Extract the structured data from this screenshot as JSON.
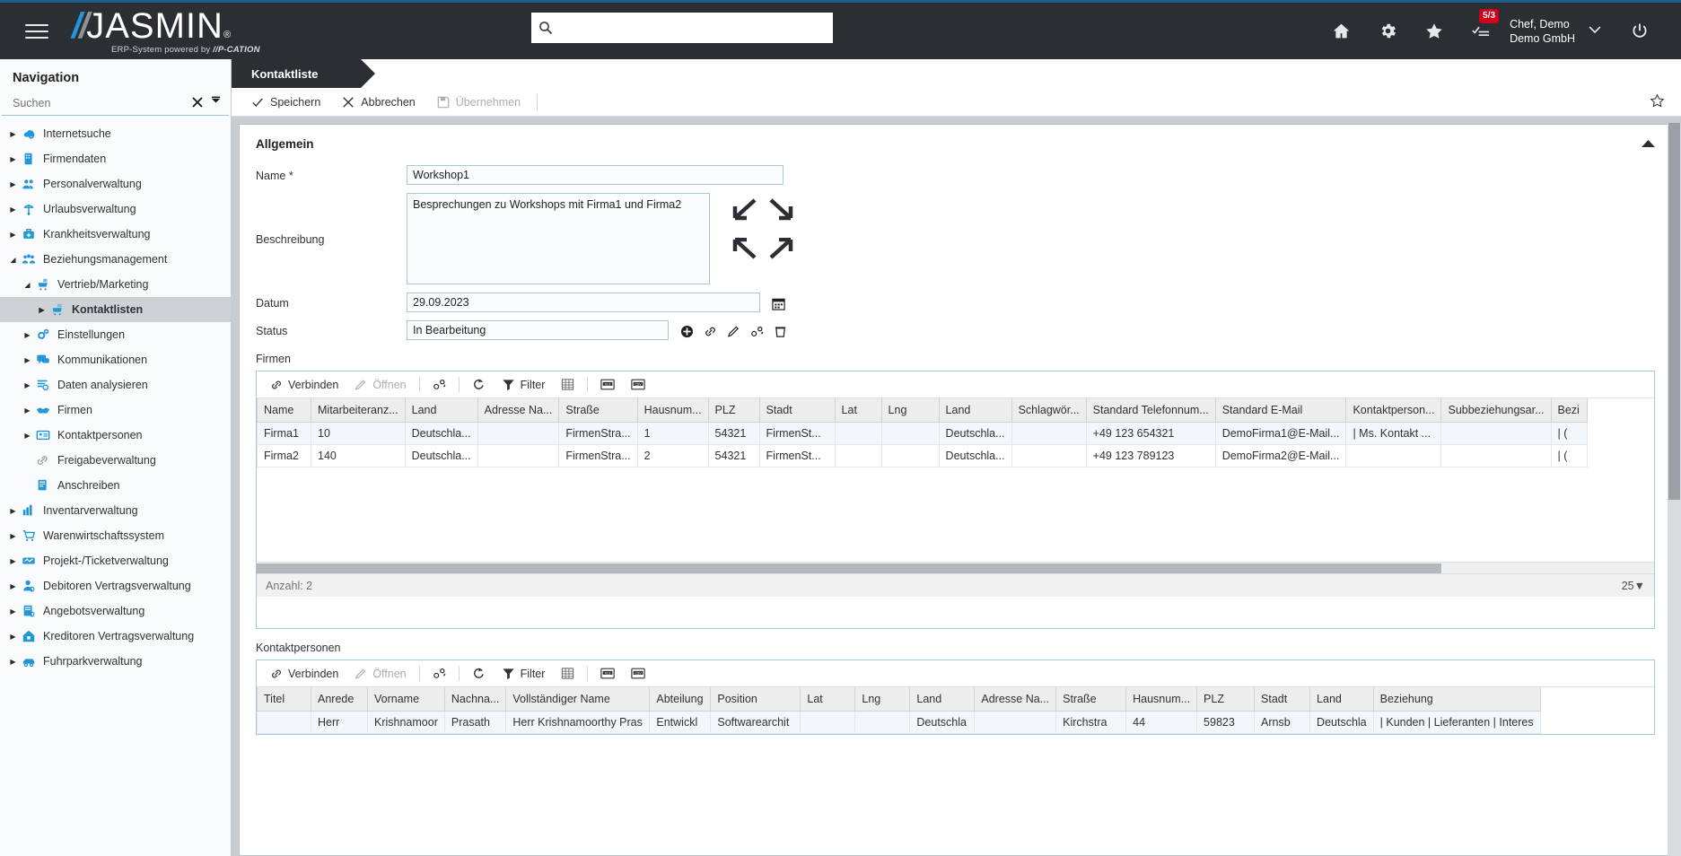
{
  "header": {
    "logo_slash": "//",
    "logo_text": "JASMIN",
    "logo_reg": "®",
    "tagline_pre": "ERP-System powered by ",
    "tagline_brand": "//P-CATION",
    "search_placeholder": "",
    "search_value": "",
    "notification_badge": "5/3",
    "user_name": "Chef, Demo",
    "user_company": "Demo GmbH",
    "icons": [
      "home-icon",
      "gear-icon",
      "star-icon",
      "tasks-icon",
      "power-icon"
    ]
  },
  "sidebar": {
    "title": "Navigation",
    "search_placeholder": "Suchen",
    "search_value": "",
    "clear_label": "×",
    "collapse_label": "⤒",
    "items": [
      {
        "label": "Internetsuche",
        "icon": "internet-search-icon",
        "level": 0,
        "arrow": "right",
        "selected": false
      },
      {
        "label": "Firmendaten",
        "icon": "company-data-icon",
        "level": 0,
        "arrow": "right",
        "selected": false
      },
      {
        "label": "Personalverwaltung",
        "icon": "personnel-icon",
        "level": 0,
        "arrow": "right",
        "selected": false
      },
      {
        "label": "Urlaubsverwaltung",
        "icon": "vacation-icon",
        "level": 0,
        "arrow": "right",
        "selected": false
      },
      {
        "label": "Krankheitsverwaltung",
        "icon": "sickness-icon",
        "level": 0,
        "arrow": "right",
        "selected": false
      },
      {
        "label": "Beziehungsmanagement",
        "icon": "relationship-icon",
        "level": 0,
        "arrow": "down",
        "selected": false
      },
      {
        "label": "Vertrieb/Marketing",
        "icon": "sales-marketing-icon",
        "level": 1,
        "arrow": "down",
        "selected": false
      },
      {
        "label": "Kontaktlisten",
        "icon": "contact-list-icon",
        "level": 2,
        "arrow": "right",
        "selected": true
      },
      {
        "label": "Einstellungen",
        "icon": "settings-icon",
        "level": 1,
        "arrow": "right",
        "selected": false
      },
      {
        "label": "Kommunikationen",
        "icon": "communication-icon",
        "level": 1,
        "arrow": "right",
        "selected": false
      },
      {
        "label": "Daten analysieren",
        "icon": "analyze-data-icon",
        "level": 1,
        "arrow": "right",
        "selected": false
      },
      {
        "label": "Firmen",
        "icon": "companies-icon",
        "level": 1,
        "arrow": "right",
        "selected": false
      },
      {
        "label": "Kontaktpersonen",
        "icon": "contact-persons-icon",
        "level": 1,
        "arrow": "right",
        "selected": false
      },
      {
        "label": "Freigabeverwaltung",
        "icon": "release-management-icon",
        "level": 1,
        "arrow": "none",
        "selected": false
      },
      {
        "label": "Anschreiben",
        "icon": "letter-icon",
        "level": 1,
        "arrow": "none",
        "selected": false
      },
      {
        "label": "Inventarverwaltung",
        "icon": "inventory-icon",
        "level": 0,
        "arrow": "right",
        "selected": false
      },
      {
        "label": "Warenwirtschaftssystem",
        "icon": "erp-cart-icon",
        "level": 0,
        "arrow": "right",
        "selected": false
      },
      {
        "label": "Projekt-/Ticketverwaltung",
        "icon": "project-ticket-icon",
        "level": 0,
        "arrow": "right",
        "selected": false
      },
      {
        "label": "Debitoren Vertragsverwaltung",
        "icon": "debtor-contract-icon",
        "level": 0,
        "arrow": "right",
        "selected": false
      },
      {
        "label": "Angebotsverwaltung",
        "icon": "offer-management-icon",
        "level": 0,
        "arrow": "right",
        "selected": false
      },
      {
        "label": "Kreditoren Vertragsverwaltung",
        "icon": "creditor-contract-icon",
        "level": 0,
        "arrow": "right",
        "selected": false
      },
      {
        "label": "Fuhrparkverwaltung",
        "icon": "fleet-icon",
        "level": 0,
        "arrow": "right",
        "selected": false
      }
    ]
  },
  "tab": {
    "label": "Kontaktliste"
  },
  "commandbar": {
    "save": "Speichern",
    "cancel": "Abbrechen",
    "apply": "Übernehmen"
  },
  "panel": {
    "title": "Allgemein",
    "fields": {
      "name_label": "Name *",
      "name_value": "Workshop1",
      "description_label": "Beschreibung",
      "description_value": "Besprechungen zu Workshops mit Firma1 und Firma2",
      "date_label": "Datum",
      "date_value": "29.09.2023",
      "status_label": "Status",
      "status_value": "In Bearbeitung"
    },
    "status_icons": [
      "add-icon",
      "link-icon",
      "edit-icon",
      "link-settings-icon",
      "delete-icon"
    ]
  },
  "grid_toolbar": {
    "connect": "Verbinden",
    "open": "Öffnen",
    "settings_icon": "column-settings-icon",
    "refresh_icon": "refresh-icon",
    "filter": "Filter",
    "table_icon": "table-layout-icon",
    "xls_icon": "xls-export-icon",
    "csv_icon": "csv-export-icon"
  },
  "firmen": {
    "section_label": "Firmen",
    "columns": [
      "Name",
      "Mitarbeiteranz...",
      "Land",
      "Adresse Na...",
      "Straße",
      "Hausnum...",
      "PLZ",
      "Stadt",
      "Lat",
      "Lng",
      "Land",
      "Schlagwör...",
      "Standard Telefonnum...",
      "Standard E-Mail",
      "Kontaktperson...",
      "Subbeziehungsar...",
      "Bezi"
    ],
    "rows": [
      [
        "Firma1",
        "10",
        "Deutschla...",
        "",
        "FirmenStra...",
        "1",
        "54321",
        "FirmenSt...",
        "",
        "",
        "Deutschla...",
        "",
        "+49 123 654321",
        "DemoFirma1@E-Mail...",
        "| Ms. Kontakt ...",
        "",
        "| ("
      ],
      [
        "Firma2",
        "140",
        "Deutschla...",
        "",
        "FirmenStra...",
        "2",
        "54321",
        "FirmenSt...",
        "",
        "",
        "Deutschla...",
        "",
        "+49 123 789123",
        "DemoFirma2@E-Mail...",
        "",
        "",
        "| ("
      ]
    ],
    "footer_count": "Anzahl: 2",
    "page_size": "25"
  },
  "kontaktpersonen": {
    "section_label": "Kontaktpersonen",
    "columns": [
      "Titel",
      "Anrede",
      "Vorname",
      "Nachna...",
      "Vollständiger Name",
      "Abteilung",
      "Position",
      "Lat",
      "Lng",
      "Land",
      "Adresse Na...",
      "Straße",
      "Hausnum...",
      "PLZ",
      "Stadt",
      "Land",
      "Beziehung"
    ],
    "rows": [
      [
        "",
        "Herr",
        "Krishnamoor",
        "Prasath",
        "Herr Krishnamoorthy Pras",
        "Entwickl",
        "Softwarearchit",
        "",
        "",
        "Deutschla",
        "",
        "Kirchstra",
        "44",
        "59823",
        "Arnsb",
        "Deutschla",
        "| Kunden | Lieferanten | Interes"
      ]
    ]
  },
  "colors": {
    "header_bg": "#2b2f33",
    "accent_blue": "#2196d8",
    "badge_red": "#d0021b",
    "selection_grey": "#cfd2d5"
  }
}
